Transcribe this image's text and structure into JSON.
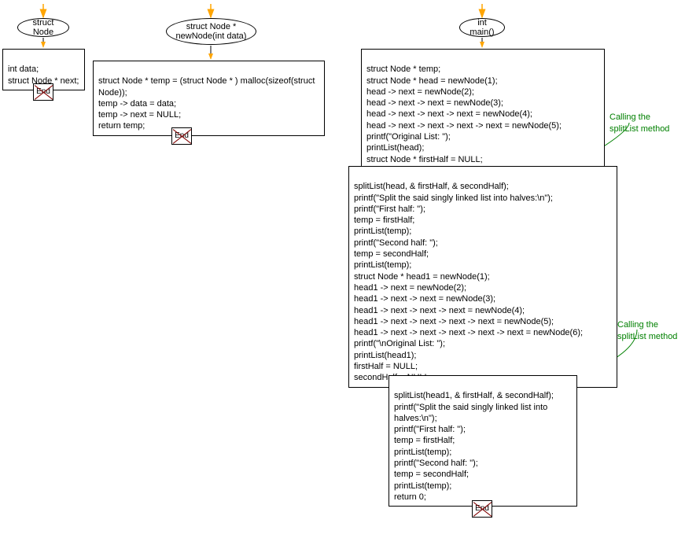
{
  "node1": {
    "title": "struct Node"
  },
  "node1_box": "int data;\nstruct Node * next;",
  "node2": {
    "title": "struct Node *\nnewNode(int data)"
  },
  "node2_box": "struct Node * temp = (struct Node * ) malloc(sizeof(struct\nNode));\ntemp -> data = data;\ntemp -> next = NULL;\nreturn temp;",
  "node3": {
    "title": "int main()"
  },
  "node3_box1": "struct Node * temp;\nstruct Node * head = newNode(1);\nhead -> next = newNode(2);\nhead -> next -> next = newNode(3);\nhead -> next -> next -> next = newNode(4);\nhead -> next -> next -> next -> next = newNode(5);\nprintf(\"Original List: \");\nprintList(head);\nstruct Node * firstHalf = NULL;\nstruct Node * secondHalf = NULL;",
  "node3_box2": "splitList(head, & firstHalf, & secondHalf);\nprintf(\"Split the said singly linked list into halves:\\n\");\nprintf(\"First half: \");\ntemp = firstHalf;\nprintList(temp);\nprintf(\"Second half: \");\ntemp = secondHalf;\nprintList(temp);\nstruct Node * head1 = newNode(1);\nhead1 -> next = newNode(2);\nhead1 -> next -> next = newNode(3);\nhead1 -> next -> next -> next = newNode(4);\nhead1 -> next -> next -> next -> next = newNode(5);\nhead1 -> next -> next -> next -> next -> next = newNode(6);\nprintf(\"\\nOriginal List: \");\nprintList(head1);\nfirstHalf = NULL;\nsecondHalf = NULL;",
  "node3_box3": "splitList(head1, & firstHalf, & secondHalf);\nprintf(\"Split the said singly linked list into\nhalves:\\n\");\nprintf(\"First half: \");\ntemp = firstHalf;\nprintList(temp);\nprintf(\"Second half: \");\ntemp = secondHalf;\nprintList(temp);\nreturn 0;",
  "annotation1": "Calling the\nsplitList method",
  "annotation2": "Calling the\nsplitList method",
  "end": "End"
}
